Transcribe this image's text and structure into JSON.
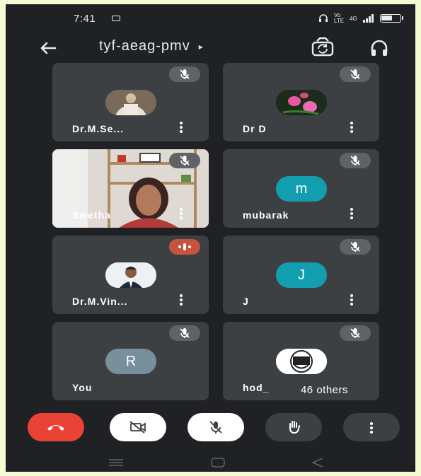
{
  "status_bar": {
    "time": "7:41",
    "network": "Vo LTE",
    "signal": "4G"
  },
  "meeting": {
    "code": "tyf-aeag-pmv",
    "caret": "▸"
  },
  "participants": [
    {
      "name": "Dr.M.Se...",
      "avatar": "photo-portrait-icon",
      "status": "muted"
    },
    {
      "name": "Dr D",
      "avatar": "lotus-flowers-icon",
      "status": "muted"
    },
    {
      "name": "Swetha",
      "avatar": "live-video",
      "status": "muted"
    },
    {
      "name": "mubarak",
      "avatar_letter": "m",
      "avatar_color": "#129eaf",
      "status": "muted"
    },
    {
      "name": "Dr.M.Vin...",
      "avatar": "man-portrait-icon",
      "status": "speaking"
    },
    {
      "name": "J",
      "avatar_letter": "J",
      "avatar_color": "#129eaf",
      "status": "muted"
    },
    {
      "name": "You",
      "avatar_letter": "R",
      "avatar_color": "#78909c",
      "status": "muted"
    },
    {
      "name": "hod_",
      "avatar": "emblem-logo-icon",
      "status": "muted"
    }
  ],
  "others_badge": "46 others",
  "colors": {
    "background": "#202124",
    "tile": "#3c4043",
    "end_call": "#ea4335",
    "accent_teal": "#129eaf"
  }
}
